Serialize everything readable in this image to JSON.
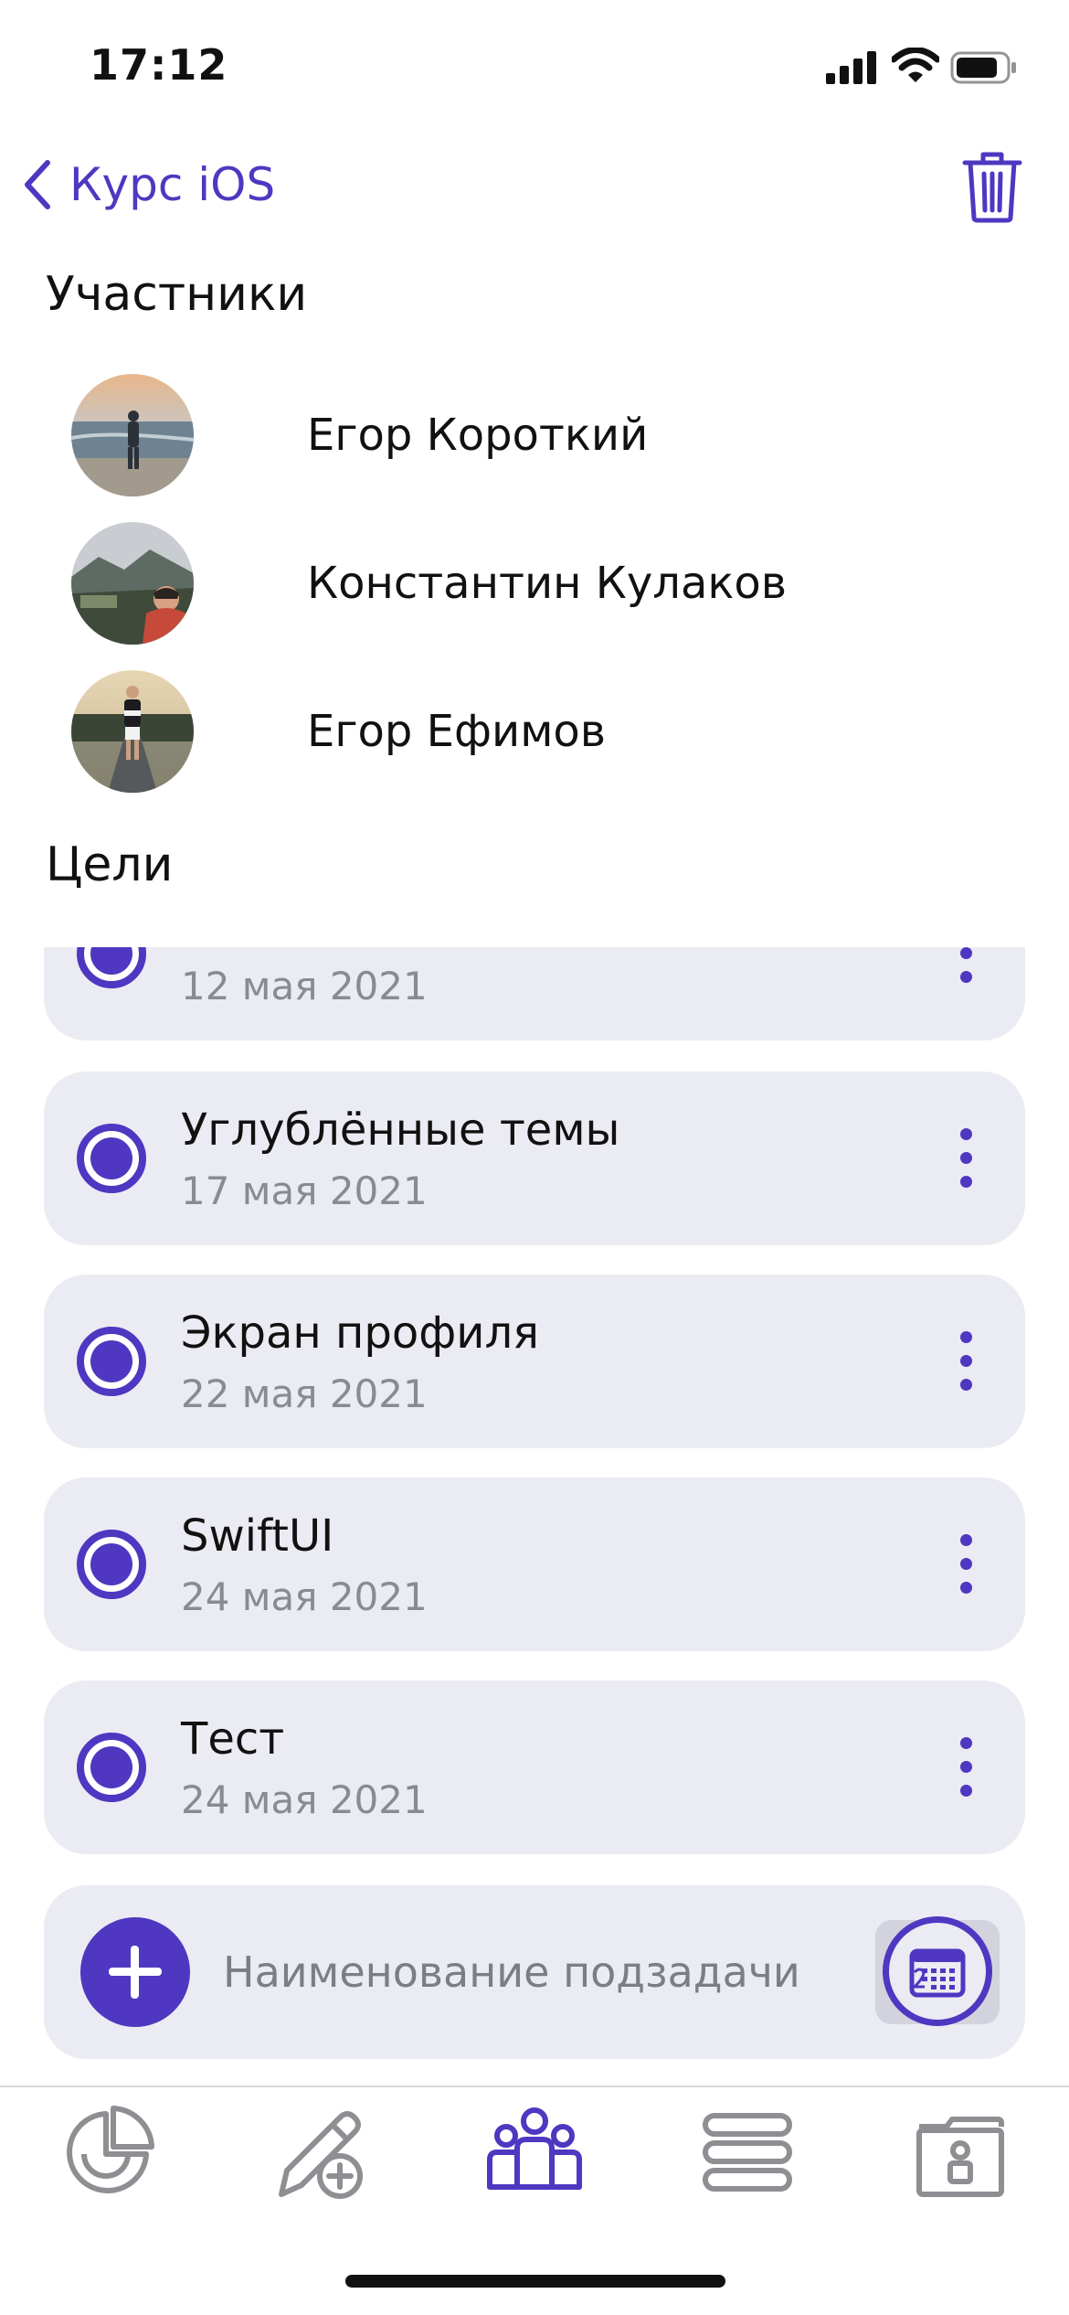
{
  "status_bar": {
    "time": "17:12"
  },
  "nav": {
    "back_label": "Курс iOS"
  },
  "members_section": {
    "title": "Участники",
    "members": [
      {
        "name": "Егор Короткий"
      },
      {
        "name": "Константин Кулаков"
      },
      {
        "name": "Егор Ефимов"
      }
    ]
  },
  "goals_section": {
    "title": "Цели",
    "goals": [
      {
        "title": "",
        "date": "12 мая 2021"
      },
      {
        "title": "Углублённые темы",
        "date": "17 мая 2021"
      },
      {
        "title": "Экран профиля",
        "date": "22 мая 2021"
      },
      {
        "title": "SwiftUI",
        "date": "24 мая 2021"
      },
      {
        "title": "Тест",
        "date": "24 мая 2021"
      }
    ]
  },
  "add_subtask": {
    "placeholder": "Наименование подзадачи"
  },
  "tab_bar": {
    "tabs": [
      {
        "icon": "pie-chart-icon",
        "active": false
      },
      {
        "icon": "pen-add-icon",
        "active": false
      },
      {
        "icon": "people-icon",
        "active": true
      },
      {
        "icon": "list-icon",
        "active": false
      },
      {
        "icon": "folder-person-icon",
        "active": false
      }
    ]
  },
  "colors": {
    "accent": "#4f37c1",
    "card": "#ebebf3",
    "muted": "#8a8a92",
    "inactive_icon": "#8e8e93"
  }
}
